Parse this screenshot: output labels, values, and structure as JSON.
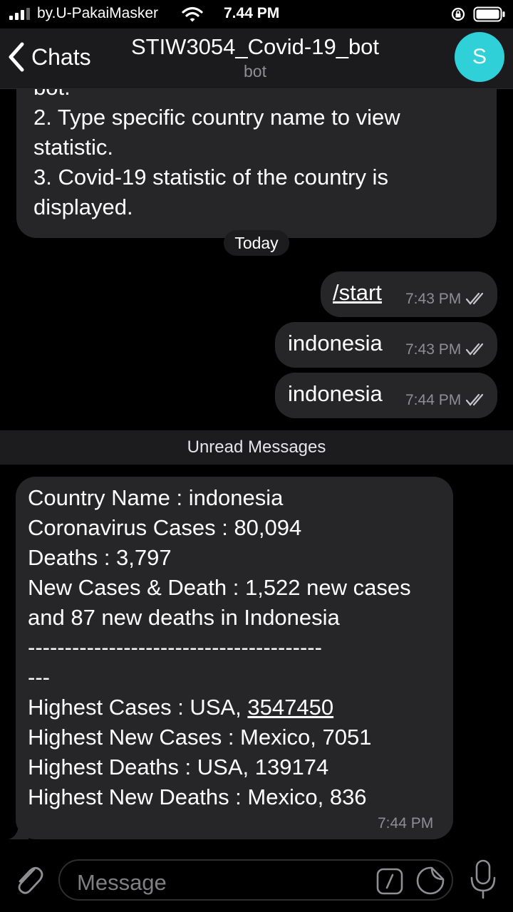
{
  "status_bar": {
    "carrier": "by.U-PakaiMasker",
    "time": "7.44 PM"
  },
  "header": {
    "back_label": "Chats",
    "title": "STIW3054_Covid-19_bot",
    "subtitle": "bot",
    "avatar_letter": "S"
  },
  "intro_message": {
    "text": "bot.\n2. Type specific country name to view\nstatistic.\n3. Covid-19 statistic of the country is\ndisplayed."
  },
  "date_separator": "Today",
  "outgoing": [
    {
      "text": "/start",
      "time": "7:43 PM"
    },
    {
      "text": "indonesia",
      "time": "7:43 PM"
    },
    {
      "text": "indonesia",
      "time": "7:44 PM"
    }
  ],
  "unread_label": "Unread Messages",
  "stats_message": {
    "before_link": "Country Name : indonesia\nCoronavirus Cases : 80,094\nDeaths : 3,797\nNew Cases & Death : 1,522 new cases\nand 87 new deaths in Indonesia\n----------------------------------------\n---\nHighest Cases : USA, ",
    "link": "3547450",
    "after_link": "\nHighest New Cases : Mexico, 7051\nHighest Deaths : USA, 139174\nHighest New Deaths : Mexico, 836",
    "time": "7:44 PM"
  },
  "input_bar": {
    "placeholder": "Message"
  }
}
